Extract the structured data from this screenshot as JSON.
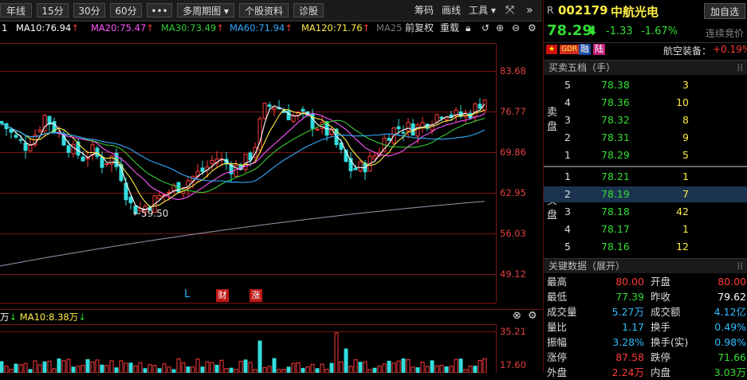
{
  "toolbar": {
    "items": [
      "年线",
      "15分",
      "30分",
      "60分",
      "•••",
      "多周期图 ▾",
      "个股资料",
      "诊股"
    ],
    "right_items": [
      "筹码",
      "画线",
      "工具 ▾"
    ]
  },
  "ma_legend": {
    "ma5": "1",
    "ma10": "MA10:76.94",
    "ma20": "MA20:75.47",
    "ma30": "MA30:73.49",
    "ma60": "MA60:71.94",
    "ma120": "MA120:71.76",
    "ma250": "MA25",
    "controls": [
      "前复权",
      "重载"
    ],
    "colors": {
      "ma10": "#ffffff",
      "ma20": "#ff55ff",
      "ma30": "#33cc33",
      "ma60": "#33aaff",
      "ma120": "#ffee44",
      "ma250": "#777777"
    }
  },
  "y_axis": [
    "83.68",
    "76.77",
    "69.86",
    "62.95",
    "56.03",
    "49.12"
  ],
  "chart_markers": {
    "low_label": "←59.50",
    "l_marker": "L",
    "cai": "财",
    "zhang": "涨"
  },
  "volume_panel": {
    "legend_left": "万",
    "legend_ma10": "MA10:8.38万",
    "y_axis": [
      "35.21",
      "17.60"
    ]
  },
  "stock": {
    "prefix": "R",
    "code": "002179",
    "name": "中航光电",
    "add_label": "加自选",
    "price": "78.29",
    "change": "-1.33",
    "change_pct": "-1.67%",
    "auction_label": "连续竞价",
    "flags": [
      "GDR",
      "融",
      "陆"
    ],
    "sector": "航空装备：",
    "sector_pct": "+0.19%"
  },
  "order_book": {
    "title": "买卖五档（手）",
    "sell_label": "卖盘",
    "buy_label": "买盘",
    "sells": [
      {
        "level": "5",
        "price": "78.38",
        "vol": "3"
      },
      {
        "level": "4",
        "price": "78.36",
        "vol": "10"
      },
      {
        "level": "3",
        "price": "78.32",
        "vol": "8"
      },
      {
        "level": "2",
        "price": "78.31",
        "vol": "9"
      },
      {
        "level": "1",
        "price": "78.29",
        "vol": "5"
      }
    ],
    "buys": [
      {
        "level": "1",
        "price": "78.21",
        "vol": "1"
      },
      {
        "level": "2",
        "price": "78.19",
        "vol": "7"
      },
      {
        "level": "3",
        "price": "78.18",
        "vol": "42"
      },
      {
        "level": "4",
        "price": "78.17",
        "vol": "1"
      },
      {
        "level": "5",
        "price": "78.16",
        "vol": "12"
      }
    ]
  },
  "key_data": {
    "title": "关键数据（展开）",
    "rows": [
      {
        "l1": "最高",
        "v1": "80.00",
        "c1": "#ff3b3b",
        "l2": "开盘",
        "v2": "80.00",
        "c2": "#ff3b3b"
      },
      {
        "l1": "最低",
        "v1": "77.39",
        "c1": "#33dd33",
        "l2": "昨收",
        "v2": "79.62",
        "c2": "#ffffff"
      },
      {
        "l1": "成交量",
        "v1": "5.27万",
        "c1": "#33bbff",
        "l2": "成交额",
        "v2": "4.12亿",
        "c2": "#33bbff"
      },
      {
        "l1": "量比",
        "v1": "1.17",
        "c1": "#33bbff",
        "l2": "换手",
        "v2": "0.49%",
        "c2": "#33bbff"
      },
      {
        "l1": "振幅",
        "v1": "3.28%",
        "c1": "#33bbff",
        "l2": "换手(实)",
        "v2": "0.98%",
        "c2": "#33bbff"
      },
      {
        "l1": "涨停",
        "v1": "87.58",
        "c1": "#ff3b3b",
        "l2": "跌停",
        "v2": "71.66",
        "c2": "#33dd33"
      },
      {
        "l1": "外盘",
        "v1": "2.24万",
        "c1": "#ff3b3b",
        "l2": "内盘",
        "v2": "3.03万",
        "c2": "#33dd33"
      }
    ]
  }
}
